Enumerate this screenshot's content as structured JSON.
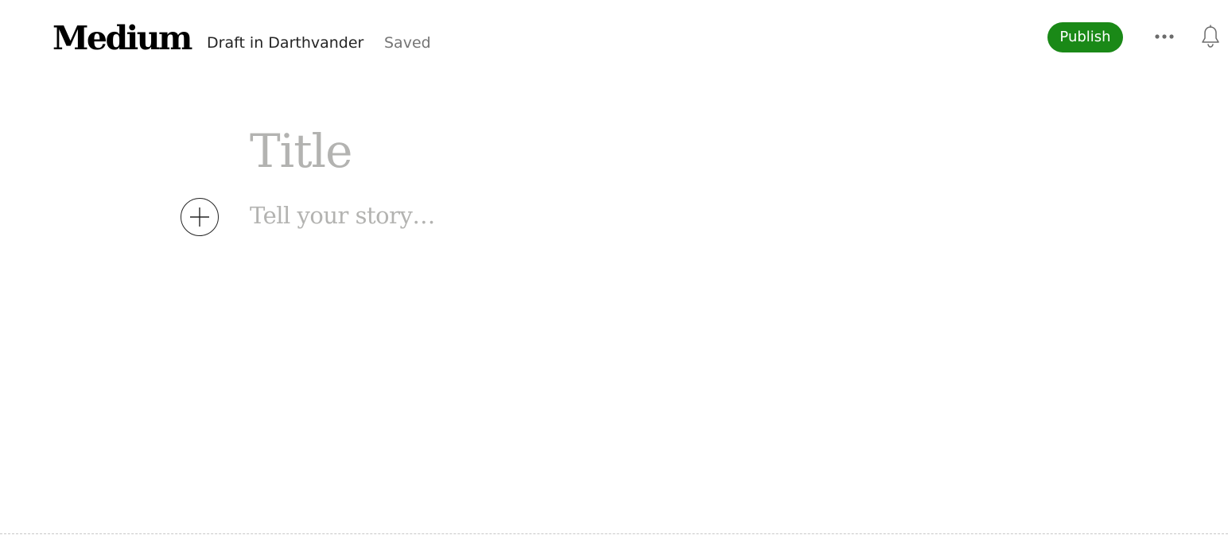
{
  "header": {
    "logo_text": "Medium",
    "draft_label": "Draft in Darthvander",
    "save_status": "Saved",
    "publish_label": "Publish",
    "more_icon": "more-horizontal-icon",
    "notification_icon": "bell-icon"
  },
  "editor": {
    "title_placeholder": "Title",
    "body_placeholder": "Tell your story…",
    "add_icon": "plus-icon"
  },
  "colors": {
    "publish_green": "#1a8917",
    "placeholder_gray": "#b3b3b1",
    "text_dark": "#242424",
    "text_muted": "#757575"
  }
}
